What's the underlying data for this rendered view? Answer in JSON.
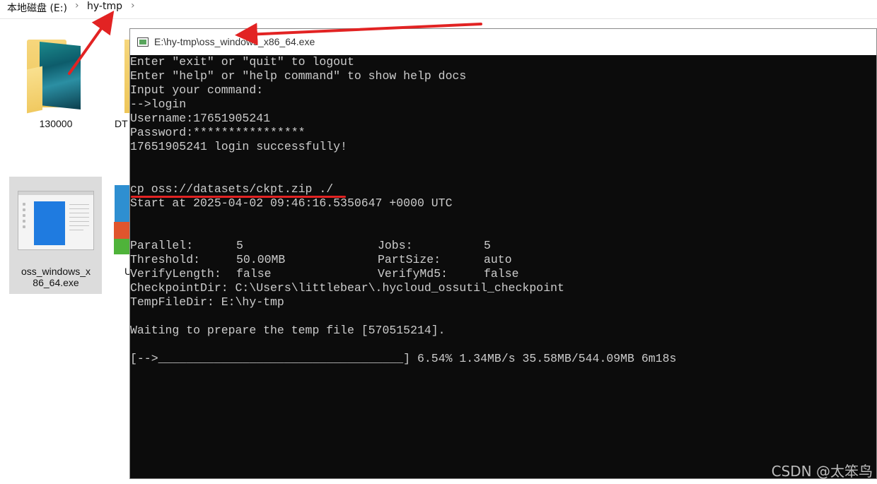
{
  "breadcrumb": {
    "drive": "本地磁盘 (E:)",
    "folder": "hy-tmp",
    "sep": "›"
  },
  "desktop": {
    "folder1_label": "130000",
    "folder2_label": "DT",
    "exe_label_line1": "oss_windows_x",
    "exe_label_line2": "86_64.exe",
    "cube_label": "U"
  },
  "console": {
    "title": "E:\\hy-tmp\\oss_windows_x86_64.exe",
    "lines": [
      "Enter \"exit\" or \"quit\" to logout",
      "Enter \"help\" or \"help command\" to show help docs",
      "Input your command:",
      "-->login",
      "Username:17651905241",
      "Password:****************",
      "17651905241 login successfully!",
      "",
      "",
      "cp oss://datasets/ckpt.zip ./",
      "Start at 2025-04-02 09:46:16.5350647 +0000 UTC"
    ],
    "params": {
      "parallel_label": "Parallel:",
      "parallel_value": "5",
      "jobs_label": "Jobs:",
      "jobs_value": "5",
      "threshold_label": "Threshold:",
      "threshold_value": "50.00MB",
      "partsize_label": "PartSize:",
      "partsize_value": "auto",
      "verifylength_label": "VerifyLength:",
      "verifylength_value": "false",
      "verifymd5_label": "VerifyMd5:",
      "verifymd5_value": "false",
      "checkpointdir_line": "CheckpointDir: C:\\Users\\littlebear\\.hycloud_ossutil_checkpoint",
      "tempfiledir_line": "TempFileDir: E:\\hy-tmp"
    },
    "waiting": "Waiting to prepare the temp file [570515214].",
    "progress": {
      "bar": "[-->___________________________________]",
      "percent": "6.54%",
      "fraction": 0.0654,
      "speed": "1.34MB/s",
      "transferred": "35.58MB/544.09MB",
      "eta": "6m18s"
    }
  },
  "watermark": "CSDN @太笨鸟",
  "colors": {
    "console_bg": "#0c0c0c",
    "console_fg": "#cccccc",
    "annotation_red": "#e22323",
    "exe_blue": "#1f7be0"
  },
  "icons": [
    "folder-icon",
    "exe-icon",
    "console-window-icon",
    "chevron-right-icon"
  ]
}
